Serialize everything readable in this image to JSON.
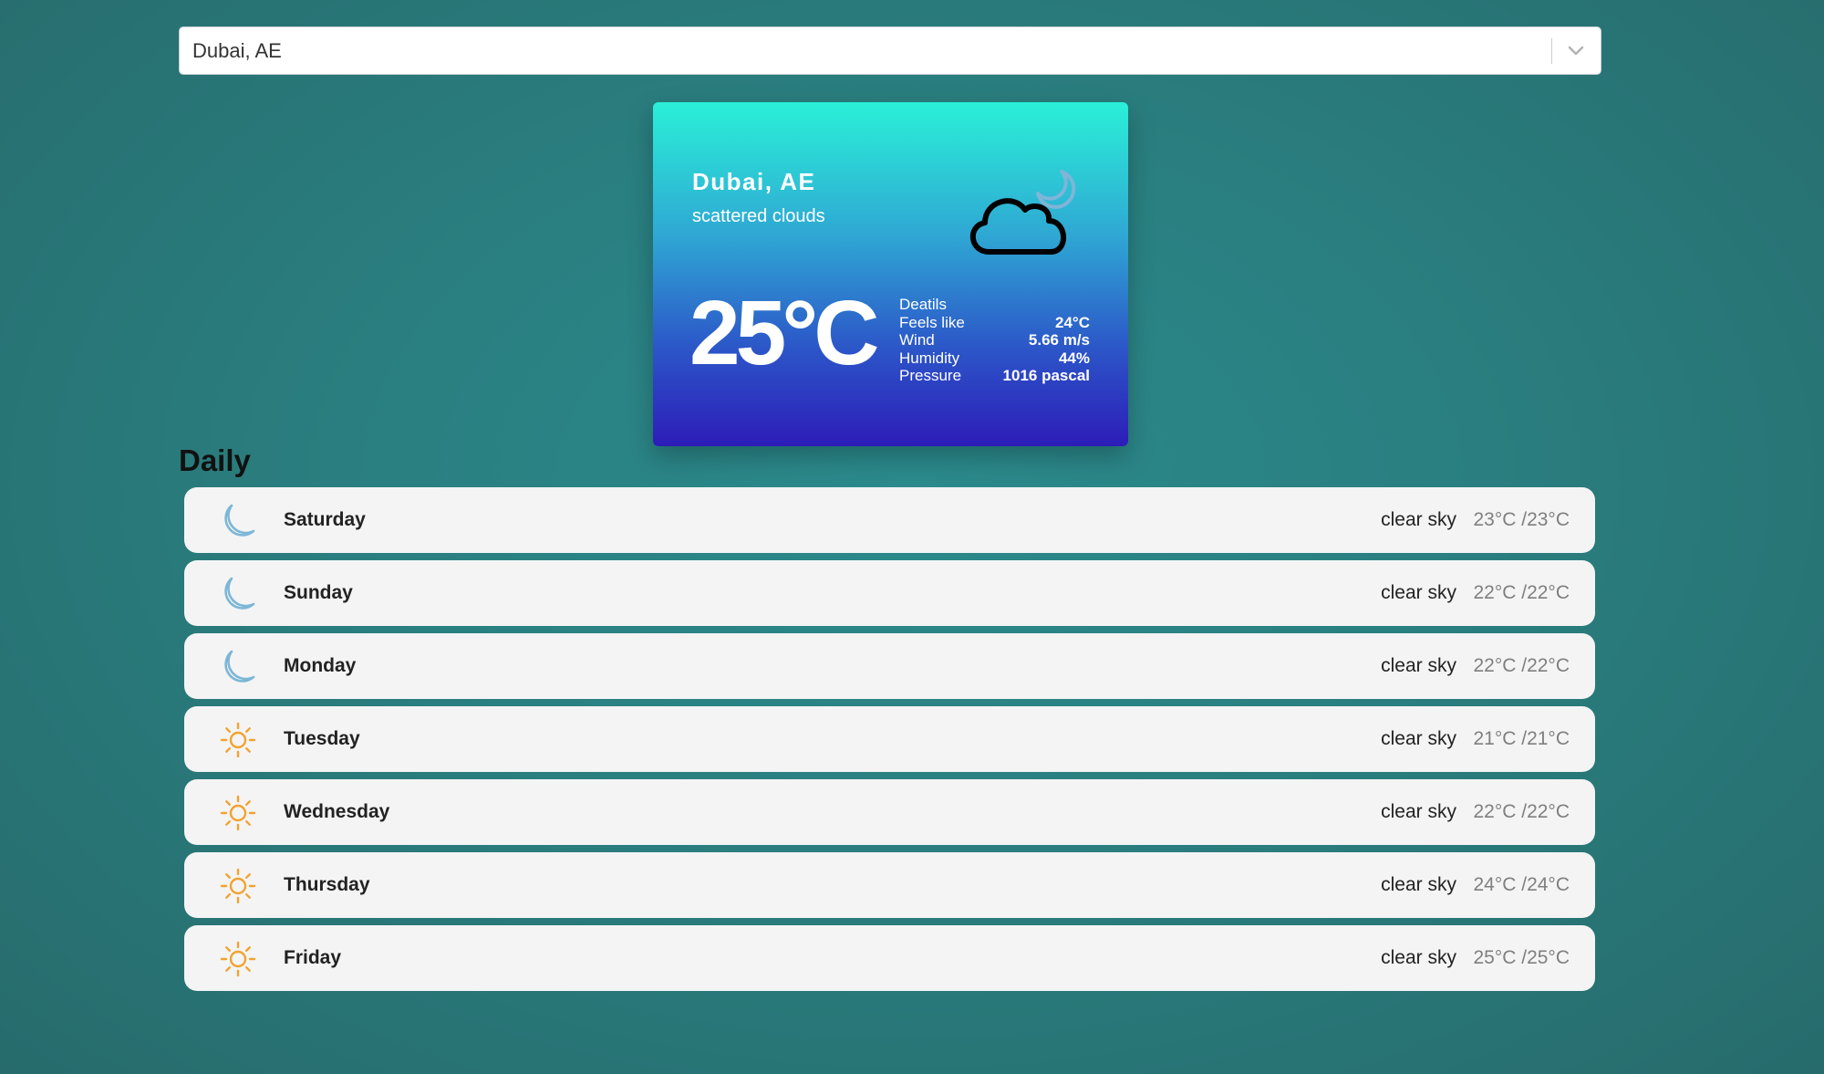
{
  "search": {
    "value": "Dubai, AE"
  },
  "current": {
    "city": "Dubai, AE",
    "description": "scattered clouds",
    "icon": "cloud-moon-icon",
    "temperature": "25°C",
    "details_title": "Deatils",
    "details": [
      {
        "label": "Feels like",
        "value": "24°C"
      },
      {
        "label": "Wind",
        "value": "5.66 m/s"
      },
      {
        "label": "Humidity",
        "value": "44%"
      },
      {
        "label": "Pressure",
        "value": "1016 pascal"
      }
    ]
  },
  "daily": {
    "title": "Daily",
    "days": [
      {
        "day": "Saturday",
        "icon": "moon-icon",
        "description": "clear sky",
        "temp": "23°C /23°C"
      },
      {
        "day": "Sunday",
        "icon": "moon-icon",
        "description": "clear sky",
        "temp": "22°C /22°C"
      },
      {
        "day": "Monday",
        "icon": "moon-icon",
        "description": "clear sky",
        "temp": "22°C /22°C"
      },
      {
        "day": "Tuesday",
        "icon": "sun-icon",
        "description": "clear sky",
        "temp": "21°C /21°C"
      },
      {
        "day": "Wednesday",
        "icon": "sun-icon",
        "description": "clear sky",
        "temp": "22°C /22°C"
      },
      {
        "day": "Thursday",
        "icon": "sun-icon",
        "description": "clear sky",
        "temp": "24°C /24°C"
      },
      {
        "day": "Friday",
        "icon": "sun-icon",
        "description": "clear sky",
        "temp": "25°C /25°C"
      }
    ]
  },
  "colors": {
    "moon": "#7db6d6",
    "sun": "#f3a230"
  }
}
